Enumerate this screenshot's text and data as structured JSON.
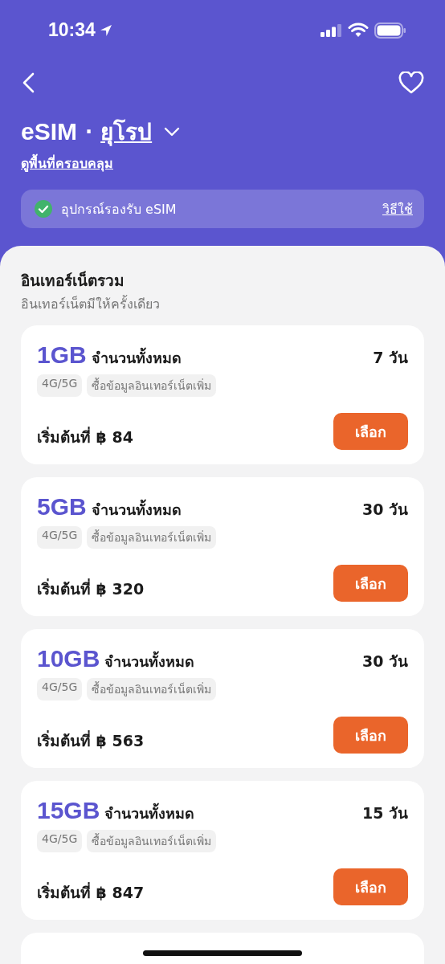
{
  "status_bar": {
    "time": "10:34"
  },
  "header": {
    "title": "eSIM",
    "separator": "·",
    "region": "ยุโรป",
    "coverage_link": "ดูพื้นที่ครอบคลุม"
  },
  "compat_banner": {
    "text": "อุปกรณ์รองรับ eSIM",
    "supported": true,
    "link": "วิธีใช้"
  },
  "section": {
    "title": "อินเทอร์เน็ตรวม",
    "subtitle": "อินเทอร์เน็ตมีให้ครั้งเดียว"
  },
  "plans": [
    {
      "data": "1GB",
      "data_label": "จำนวนทั้งหมด",
      "duration": "7 วัน",
      "tags": [
        "4G/5G",
        "ซื้อข้อมูลอินเทอร์เน็ตเพิ่ม"
      ],
      "price": "เริ่มต้นที่ ฿ 84",
      "button": "เลือก"
    },
    {
      "data": "5GB",
      "data_label": "จำนวนทั้งหมด",
      "duration": "30 วัน",
      "tags": [
        "4G/5G",
        "ซื้อข้อมูลอินเทอร์เน็ตเพิ่ม"
      ],
      "price": "เริ่มต้นที่ ฿ 320",
      "button": "เลือก"
    },
    {
      "data": "10GB",
      "data_label": "จำนวนทั้งหมด",
      "duration": "30 วัน",
      "tags": [
        "4G/5G",
        "ซื้อข้อมูลอินเทอร์เน็ตเพิ่ม"
      ],
      "price": "เริ่มต้นที่ ฿ 563",
      "button": "เลือก"
    },
    {
      "data": "15GB",
      "data_label": "จำนวนทั้งหมด",
      "duration": "15 วัน",
      "tags": [
        "4G/5G",
        "ซื้อข้อมูลอินเทอร์เน็ตเพิ่ม"
      ],
      "price": "เริ่มต้นที่ ฿ 847",
      "button": "เลือก"
    },
    {
      "kind": "cut"
    }
  ]
}
